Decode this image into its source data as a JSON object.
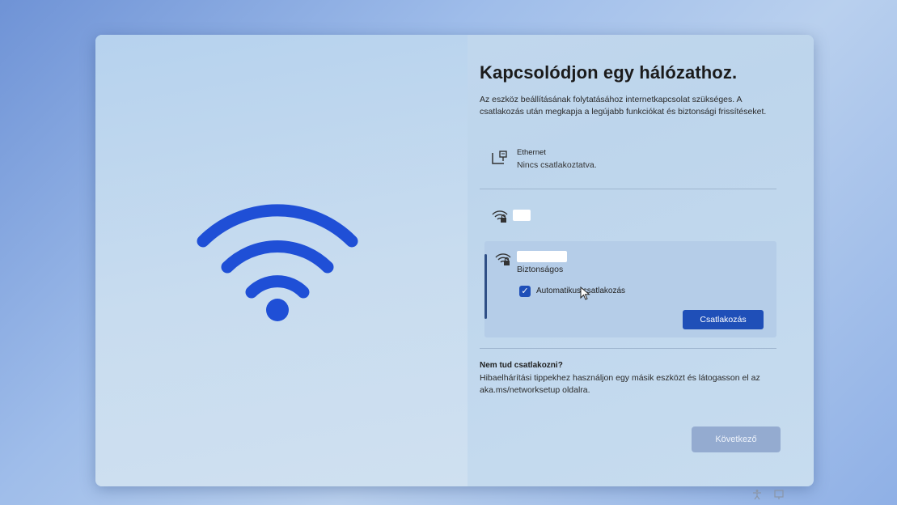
{
  "setup": {
    "title": "Kapcsolódjon egy hálózathoz.",
    "description": "Az eszköz beállításának folytatásához internetkapcsolat szükséges. A csatlakozás után megkapja a legújabb funkciókat és biztonsági frissítéseket.",
    "ethernet": {
      "icon": "ethernet-icon",
      "name": "Ethernet",
      "status": "Nincs csatlakoztatva."
    },
    "networks": [
      {
        "icon": "wifi-secured-icon",
        "ssid_redacted": true
      },
      {
        "icon": "wifi-secured-icon",
        "ssid_redacted": true,
        "selected": true,
        "security": "Biztonságos",
        "auto_connect_label": "Automatikus csatlakozás",
        "auto_connect_checked": true,
        "connect_label": "Csatlakozás"
      }
    ],
    "help": {
      "title": "Nem tud csatlakozni?",
      "text": "Hibaelhárítási tippekhez használjon egy másik eszközt és látogasson el az aka.ms/networksetup oldalra."
    },
    "next_label": "Következő"
  },
  "colors": {
    "accent": "#1f4fb8",
    "wifi_art": "#1f4fd6",
    "panel": "#c4d9ee",
    "next_disabled": "#94abd0"
  }
}
